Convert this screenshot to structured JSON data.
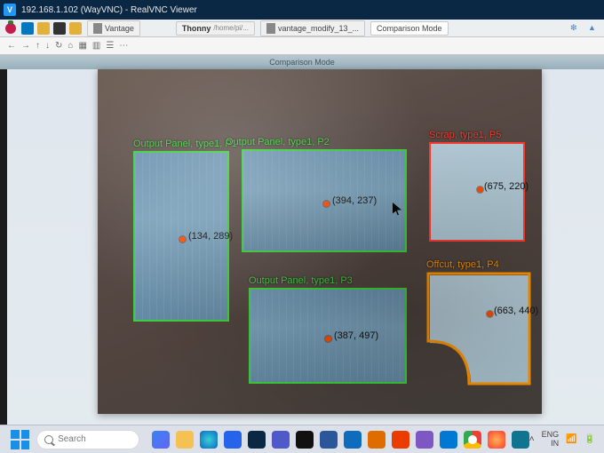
{
  "vnc_title": "192.168.1.102 (WayVNC) - RealVNC Viewer",
  "pi": {
    "task_folder": "Vantage",
    "thonny_label": "Thonny",
    "thonny_path": "/home/pi/...",
    "script_btn": "vantage_modify_13_...",
    "comp_btn": "Comparison Mode"
  },
  "fb_arrows": [
    "←",
    "→",
    "↑",
    "↻",
    "⌂",
    "▥",
    "▦",
    "☰",
    "⋯"
  ],
  "app_window_title": "Comparison Mode",
  "detections": {
    "p1": {
      "label": "Output Panel, type1, P1",
      "coord": "(134, 289)"
    },
    "p2": {
      "label": "Output Panel, type1, P2",
      "coord": "(394, 237)"
    },
    "p3": {
      "label": "Output Panel, type1, P3",
      "coord": "(387, 497)"
    },
    "p4": {
      "label": "Offcut, type1, P4",
      "coord": "(663, 440)"
    },
    "p5": {
      "label": "Scrap, type1, P5",
      "coord": "(675, 220)"
    }
  },
  "taskbar": {
    "search_placeholder": "Search",
    "lang": "ENG",
    "region": "IN"
  }
}
